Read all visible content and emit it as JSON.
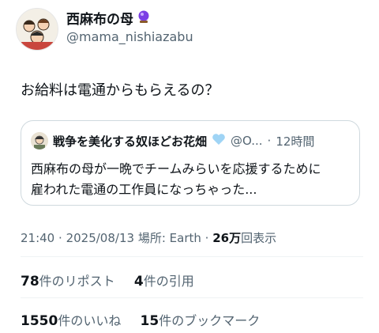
{
  "author": {
    "display_name": "西麻布の母",
    "handle": "@mama_nishiazabu"
  },
  "tweet": {
    "text": "お給料は電通からもらえるの？"
  },
  "quoted_tweet": {
    "display_name": "戦争を美化する奴ほどお花畑",
    "handle": "@O...",
    "separator": "·",
    "time": "12時間",
    "text_line1": "西麻布の母が一晩でチームみらいを応援するために",
    "text_line2": "雇われた電通の工作員になっちゃった..."
  },
  "meta": {
    "time": "21:40",
    "sep1": "·",
    "date": "2025/08/13",
    "location": "場所: Earth",
    "sep2": "·",
    "views_number": "26万",
    "views_label": "回表示"
  },
  "stats": {
    "reposts_number": "78",
    "reposts_label": "件のリポスト",
    "quotes_number": "4",
    "quotes_label": "件の引用",
    "likes_number": "1550",
    "likes_label": "件のいいね",
    "bookmarks_number": "15",
    "bookmarks_label": "件のブックマーク"
  },
  "colors": {
    "text": "#0f1419",
    "secondary": "#536471",
    "border": "#cfd9de",
    "orb": "#7b3fe4",
    "heart": "#9fd4f5"
  },
  "icons": [
    "crystal-ball-icon",
    "light-blue-heart-icon"
  ]
}
